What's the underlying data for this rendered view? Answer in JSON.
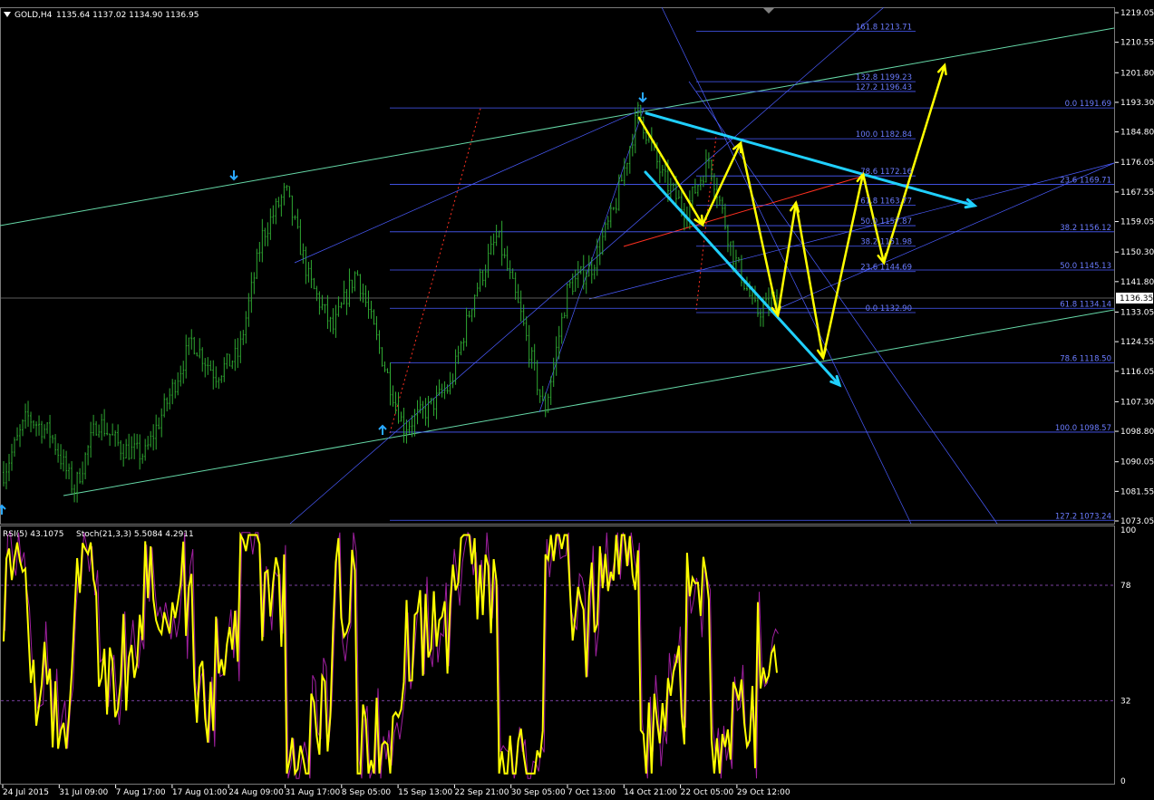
{
  "header": {
    "symbol": "GOLD,H4",
    "ohlc": "1135.64 1137.02 1134.90 1136.95",
    "collapse_icon": "triangle-down-icon"
  },
  "indicator_header": {
    "rsi": "RSI(5) 43.1075",
    "stoch": "Stoch(21,3,3) 5.5084 4.2911"
  },
  "colors": {
    "background": "#000000",
    "candles": "#2fa832",
    "rsi": "#ffff00",
    "stoch": "#a020a0",
    "fib": "#4a5cff",
    "channel": "#66d9a8",
    "cyan": "#20d0ff",
    "arrows": "#ffff00",
    "fib_red": "#ff3020",
    "grid": "#2a2a2a"
  },
  "price_axis": [
    "1219.05",
    "1210.55",
    "1201.80",
    "1193.30",
    "1184.80",
    "1176.05",
    "1167.55",
    "1159.05",
    "1150.30",
    "1141.80",
    "1133.05",
    "1124.55",
    "1116.05",
    "1107.30",
    "1098.80",
    "1090.05",
    "1081.55",
    "1073.05"
  ],
  "current_price": "1136.35",
  "indicator_axis": [
    "100",
    "78",
    "32",
    "0"
  ],
  "time_axis": [
    "24 Jul 2015",
    "31 Jul 09:00",
    "7 Aug 17:00",
    "17 Aug 01:00",
    "24 Aug 09:00",
    "31 Aug 17:00",
    "8 Sep 05:00",
    "15 Sep 13:00",
    "22 Sep 21:00",
    "30 Sep 05:00",
    "7 Oct 13:00",
    "14 Oct 21:00",
    "22 Oct 05:00",
    "29 Oct 12:00"
  ],
  "fib_labels": {
    "right": [
      "0.0 1191.69",
      "23.6 1169.71",
      "38.2 1156.12",
      "50.0 1145.13",
      "61.8 1134.14",
      "78.6 1118.50",
      "100.0 1098.57",
      "127.2 1073.24"
    ],
    "middle": [
      "161.8 1213.71",
      "132.8 1199.23",
      "127.2 1196.43",
      "100.0 1182.84",
      "78.6 1172.16",
      "61.8 1163.77",
      "50.0 1157.87",
      "38.2 1151.98",
      "23.6 1144.69",
      "0.0 1132.90"
    ]
  },
  "chart_data": {
    "type": "candlestick",
    "symbol": "GOLD",
    "timeframe": "H4",
    "ylim": [
      1073.05,
      1219.05
    ],
    "close_path": [
      {
        "t": "24 Jul 2015",
        "price": 1087
      },
      {
        "t": "25 Jul",
        "price": 1103
      },
      {
        "t": "28 Jul",
        "price": 1098
      },
      {
        "t": "31 Jul 09:00",
        "price": 1082
      },
      {
        "t": "3 Aug",
        "price": 1102
      },
      {
        "t": "5 Aug",
        "price": 1094
      },
      {
        "t": "7 Aug 17:00",
        "price": 1092
      },
      {
        "t": "10 Aug",
        "price": 1108
      },
      {
        "t": "12 Aug",
        "price": 1125
      },
      {
        "t": "14 Aug",
        "price": 1115
      },
      {
        "t": "17 Aug 01:00",
        "price": 1121
      },
      {
        "t": "20 Aug",
        "price": 1155
      },
      {
        "t": "24 Aug 09:00",
        "price": 1168
      },
      {
        "t": "26 Aug",
        "price": 1142
      },
      {
        "t": "28 Aug",
        "price": 1128
      },
      {
        "t": "31 Aug 17:00",
        "price": 1145
      },
      {
        "t": "3 Sep",
        "price": 1122
      },
      {
        "t": "8 Sep 05:00",
        "price": 1100
      },
      {
        "t": "11 Sep",
        "price": 1105
      },
      {
        "t": "15 Sep 13:00",
        "price": 1112
      },
      {
        "t": "18 Sep",
        "price": 1138
      },
      {
        "t": "22 Sep 21:00",
        "price": 1155
      },
      {
        "t": "25 Sep",
        "price": 1132
      },
      {
        "t": "30 Sep 05:00",
        "price": 1104
      },
      {
        "t": "2 Oct",
        "price": 1140
      },
      {
        "t": "7 Oct 13:00",
        "price": 1146
      },
      {
        "t": "10 Oct",
        "price": 1163
      },
      {
        "t": "14 Oct 21:00",
        "price": 1191
      },
      {
        "t": "17 Oct",
        "price": 1172
      },
      {
        "t": "20 Oct",
        "price": 1162
      },
      {
        "t": "22 Oct 05:00",
        "price": 1177
      },
      {
        "t": "26 Oct",
        "price": 1150
      },
      {
        "t": "29 Oct 12:00",
        "price": 1133
      },
      {
        "t": "30 Oct",
        "price": 1136.95
      }
    ],
    "indicators": {
      "rsi_period": 5,
      "rsi_last": 43.1075,
      "stoch_params": "21,3,3",
      "stoch_main_last": 5.5084,
      "stoch_signal_last": 4.2911,
      "levels": [
        78,
        32
      ]
    }
  }
}
